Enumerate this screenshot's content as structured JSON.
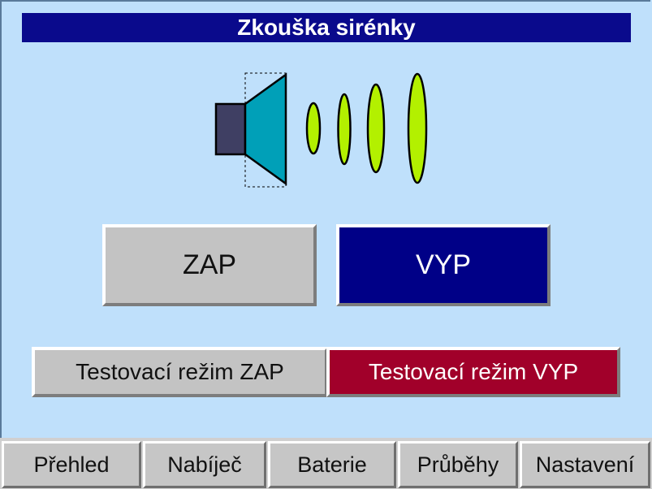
{
  "header": {
    "title": "Zkouška sirénky"
  },
  "icons": {
    "siren": "speaker-with-sound-waves-icon"
  },
  "colors": {
    "background": "#bfe0fb",
    "title_bar": "#0a0a8c",
    "on_button": "#c3c3c3",
    "off_button": "#000087",
    "test_off_button": "#a1002a",
    "speaker_body": "#00a0b8",
    "waves": "#b3f000"
  },
  "controls": {
    "on_label": "ZAP",
    "off_label": "VYP",
    "test_on_label": "Testovací režim ZAP",
    "test_off_label": "Testovací režim VYP"
  },
  "nav": {
    "items": [
      {
        "label": "Přehled"
      },
      {
        "label": "Nabíječ"
      },
      {
        "label": "Baterie"
      },
      {
        "label": "Průběhy"
      },
      {
        "label": "Nastavení"
      }
    ]
  }
}
